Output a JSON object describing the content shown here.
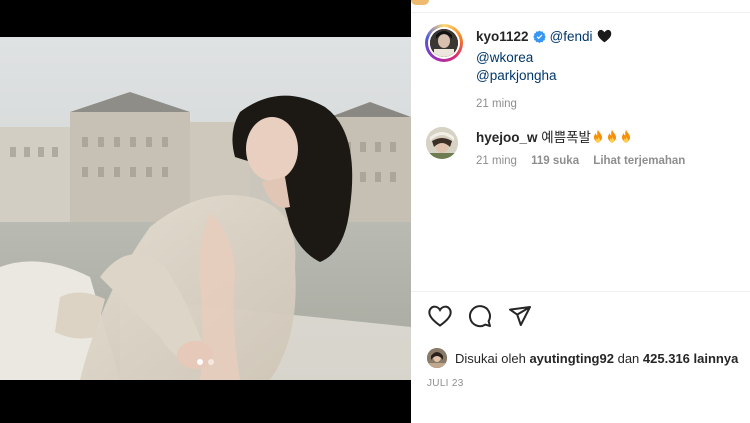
{
  "post": {
    "author": "kyo1122",
    "mentions": [
      "@fendi",
      "@wkorea",
      "@parkjongha"
    ],
    "caption_time": "21 ming",
    "carousel": {
      "count": 2,
      "active": 1
    }
  },
  "comment": {
    "username": "hyejoo_w",
    "text": "예쁨폭발",
    "time": "21 ming",
    "likes": "119 suka",
    "translate": "Lihat terjemahan"
  },
  "liked_by": {
    "prefix": "Disukai oleh",
    "user": "ayutingting92",
    "conjunction": "dan",
    "others": "425.316 lainnya"
  },
  "date": "JULI 23",
  "icons": {
    "verified": "verified-badge-icon",
    "heart": "black-heart-icon",
    "fire": "fire-emoji-icon",
    "like": "heart-outline-icon",
    "comment": "comment-bubble-icon",
    "share": "paper-plane-icon"
  },
  "colors": {
    "mention": "#00376b",
    "verified": "#3897f0",
    "muted": "#8e8e8e"
  }
}
